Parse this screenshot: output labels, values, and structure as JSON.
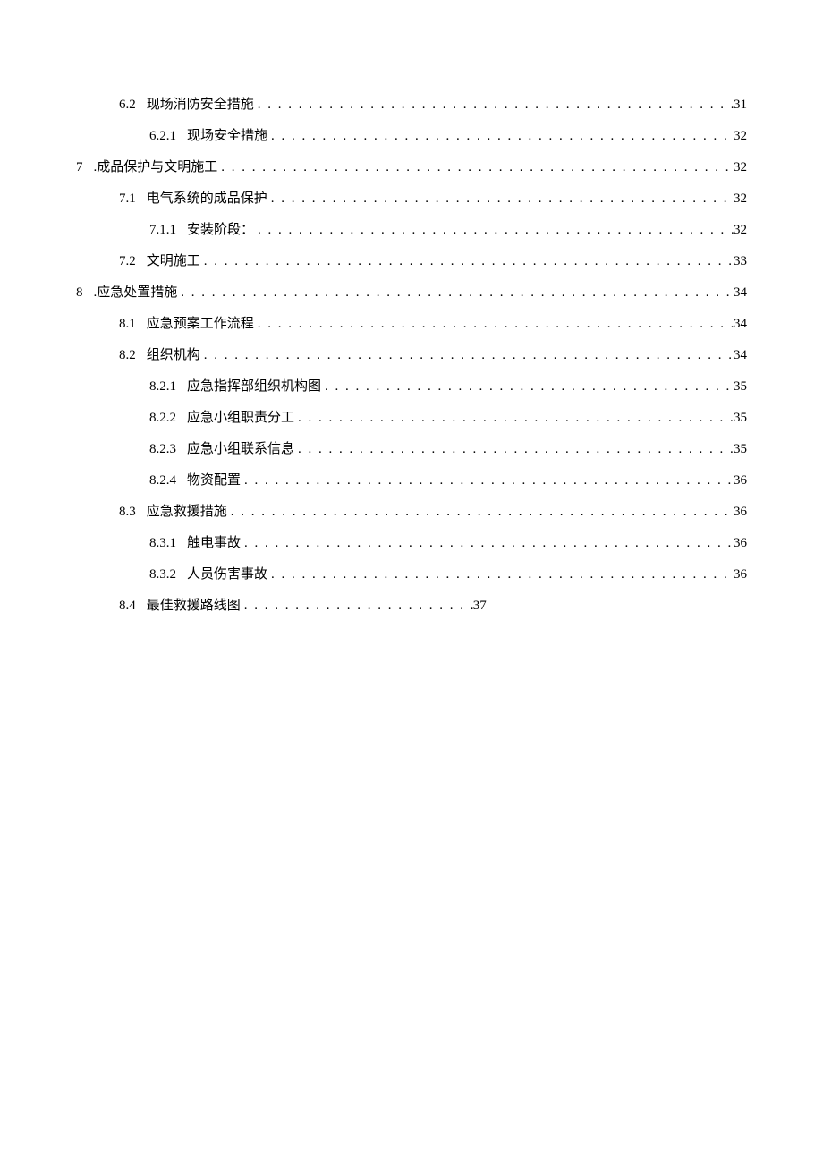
{
  "toc": [
    {
      "level": 2,
      "num": "6.2",
      "title": "现场消防安全措施",
      "page": "31",
      "short": false
    },
    {
      "level": 3,
      "num": "6.2.1",
      "title": "现场安全措施",
      "page": "32",
      "short": false
    },
    {
      "level": 1,
      "num": "7",
      "title": ".成品保护与文明施工",
      "page": "32",
      "short": false
    },
    {
      "level": 2,
      "num": "7.1",
      "title": "电气系统的成品保护",
      "page": "32",
      "short": false
    },
    {
      "level": 3,
      "num": "7.1.1",
      "title": "安装阶段：",
      "page": "32",
      "short": false
    },
    {
      "level": 2,
      "num": "7.2",
      "title": "文明施工",
      "page": "33",
      "short": false
    },
    {
      "level": 1,
      "num": "8",
      "title": ".应急处置措施",
      "page": "34",
      "short": false
    },
    {
      "level": 2,
      "num": "8.1",
      "title": "应急预案工作流程",
      "page": "34",
      "short": false
    },
    {
      "level": 2,
      "num": "8.2",
      "title": "组织机构",
      "page": "34",
      "short": false
    },
    {
      "level": 3,
      "num": "8.2.1",
      "title": "应急指挥部组织机构图",
      "page": "35",
      "short": false
    },
    {
      "level": 3,
      "num": "8.2.2",
      "title": "应急小组职责分工",
      "page": "35",
      "short": false
    },
    {
      "level": 3,
      "num": "8.2.3",
      "title": "应急小组联系信息",
      "page": "35",
      "short": false
    },
    {
      "level": 3,
      "num": "8.2.4",
      "title": "物资配置",
      "page": "36",
      "short": false
    },
    {
      "level": 2,
      "num": "8.3",
      "title": "应急救援措施",
      "page": "36",
      "short": false
    },
    {
      "level": 3,
      "num": "8.3.1",
      "title": "触电事故",
      "page": "36",
      "short": false
    },
    {
      "level": 3,
      "num": "8.3.2",
      "title": "人员伤害事故",
      "page": "36",
      "short": false
    },
    {
      "level": 2,
      "num": "8.4",
      "title": "最佳救援路线图",
      "page": "37",
      "short": true
    }
  ],
  "dots_full": ". . . . . . . . . . . . . . . . . . . . . . . . . . . . . . . . . . . . . . . . . . . . . . . . . . . . . . . . . . . . . . . . . . . . . . . . . . . . . . . . . . . . . . . . . . . . . . . . . . . . . . . . . . . . . . . . . . . . . . . . . . . . . . . . . . . . . . . . . . . . . . . . . . . . . . . . . . . . . . . . . . . . . . . . . . . . . . . . . . . . . . . . . . . . . . . . . . . .",
  "dots_short": ". . . . . . . . . . . . . . . . . . . . . . . . . . . . . . . . . . . ."
}
